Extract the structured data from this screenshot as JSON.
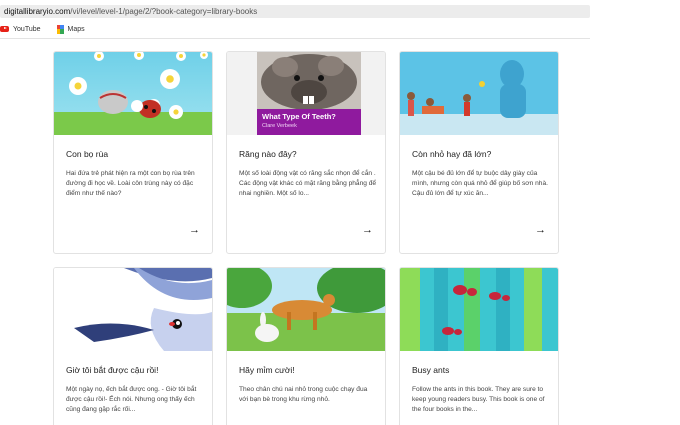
{
  "browser": {
    "url_domain": "digitallibraryio.com",
    "url_path": "/vi/level/level-1/page/2/?book-category=library-books",
    "bookmarks": [
      {
        "label": "YouTube",
        "icon": "youtube-icon"
      },
      {
        "label": "Maps",
        "icon": "maps-icon"
      }
    ]
  },
  "books": [
    {
      "title": "Con bọ rùa",
      "desc": "Hai đứa trẻ phát hiện ra một con bọ rùa trên đường đi học về. Loài côn trùng này có đặc điểm như thế nào?",
      "arrow": "→"
    },
    {
      "title": "Răng nào đây?",
      "desc": "Một số loài động vật có răng sắc nhọn để cắn . Các động vật khác có mặt răng bằng phẳng để nhai nghiền. Một số lo...",
      "arrow": "→",
      "cover_title": "What Type Of Teeth?",
      "cover_author": "Clare Verbeek"
    },
    {
      "title": "Còn nhỏ hay đã lớn?",
      "desc": "Một cậu bé đủ lớn để tự buộc dây giày của mình, nhưng còn quá nhỏ để giúp bố sơn nhà. Cậu đủ lớn để tự xúc ăn...",
      "arrow": "→"
    },
    {
      "title": "Giờ tôi bắt được cậu rồi!",
      "desc": "Một ngày nọ, ếch bắt được ong. - Giờ tôi bắt được cậu rồi!- Ếch nói. Nhưng ong thấy ếch cũng đang gặp rắc rối...",
      "arrow": "→"
    },
    {
      "title": "Hãy mỉm cười!",
      "desc": "Theo chân chú nai nhỏ trong cuộc chạy đua với bạn bè trong khu rừng nhỏ.",
      "arrow": "→"
    },
    {
      "title": "Busy ants",
      "desc": "Follow the ants in this book. They are sure to keep young readers busy. This book is one of the four books in the...",
      "arrow": "→"
    }
  ],
  "colors": {
    "cover_purple": "#8f1a9e",
    "youtube_red": "#e62117"
  }
}
